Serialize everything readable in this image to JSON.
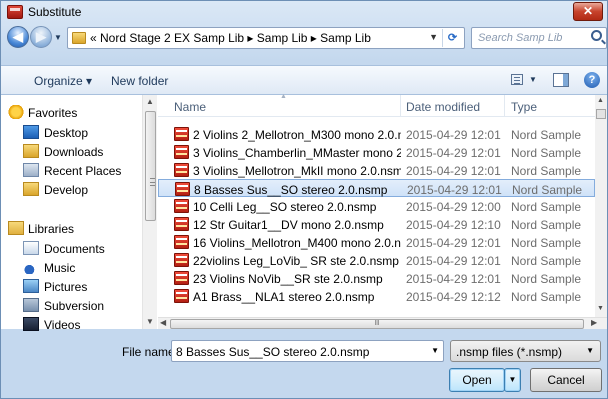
{
  "window": {
    "title": "Substitute",
    "close_label": "✕"
  },
  "nav": {
    "back_glyph": "◀",
    "forward_glyph": "▶",
    "address_prefix": "«",
    "breadcrumb": [
      "Nord Stage 2 EX Samp Lib",
      "Samp Lib",
      "Samp Lib"
    ],
    "breadcrumb_text": "«  Nord Stage 2 EX Samp Lib  ▸  Samp Lib  ▸  Samp Lib",
    "search_placeholder": "Search Samp Lib"
  },
  "toolbar": {
    "organize_label": "Organize ▾",
    "new_folder_label": "New folder",
    "help_label": "?"
  },
  "sidebar": {
    "items": [
      {
        "label": "Favorites",
        "icon": "star-icon",
        "group": true
      },
      {
        "label": "Desktop",
        "icon": "desktop-icon"
      },
      {
        "label": "Downloads",
        "icon": "downloads-icon"
      },
      {
        "label": "Recent Places",
        "icon": "recent-places-icon"
      },
      {
        "label": "Develop",
        "icon": "folder-icon"
      },
      {
        "label": "Libraries",
        "icon": "libraries-icon",
        "group": true
      },
      {
        "label": "Documents",
        "icon": "documents-icon"
      },
      {
        "label": "Music",
        "icon": "music-icon"
      },
      {
        "label": "Pictures",
        "icon": "pictures-icon"
      },
      {
        "label": "Subversion",
        "icon": "subversion-icon"
      },
      {
        "label": "Videos",
        "icon": "videos-icon"
      }
    ]
  },
  "file_list": {
    "columns": [
      "Name",
      "Date modified",
      "Type"
    ],
    "rows": [
      {
        "name": "2 Violins 2_Mellotron_M300 mono 2.0.ns...",
        "date": "2015-04-29 12:01",
        "type": "Nord Sample"
      },
      {
        "name": "3 Violins_Chamberlin_MMaster mono 2.0....",
        "date": "2015-04-29 12:01",
        "type": "Nord Sample"
      },
      {
        "name": "3 Violins_Mellotron_MkII mono 2.0.nsmp",
        "date": "2015-04-29 12:01",
        "type": "Nord Sample"
      },
      {
        "name": "8 Basses Sus__SO stereo 2.0.nsmp",
        "date": "2015-04-29 12:01",
        "type": "Nord Sample",
        "selected": true
      },
      {
        "name": "10 Celli Leg__SO stereo 2.0.nsmp",
        "date": "2015-04-29 12:00",
        "type": "Nord Sample"
      },
      {
        "name": "12 Str Guitar1__DV mono 2.0.nsmp",
        "date": "2015-04-29 12:10",
        "type": "Nord Sample"
      },
      {
        "name": "16 Violins_Mellotron_M400 mono 2.0.ns...",
        "date": "2015-04-29 12:01",
        "type": "Nord Sample"
      },
      {
        "name": "22violins Leg_LoVib_ SR ste 2.0.nsmp",
        "date": "2015-04-29 12:01",
        "type": "Nord Sample"
      },
      {
        "name": "23 Violins NoVib__SR ste 2.0.nsmp",
        "date": "2015-04-29 12:01",
        "type": "Nord Sample"
      },
      {
        "name": "A1 Brass__NLA1 stereo 2.0.nsmp",
        "date": "2015-04-29 12:12",
        "type": "Nord Sample"
      }
    ]
  },
  "footer": {
    "file_name_label": "File name:",
    "file_name_value": "8 Basses Sus__SO stereo 2.0.nsmp",
    "file_type_value": ".nsmp files (*.nsmp)",
    "open_label": "Open",
    "cancel_label": "Cancel"
  }
}
